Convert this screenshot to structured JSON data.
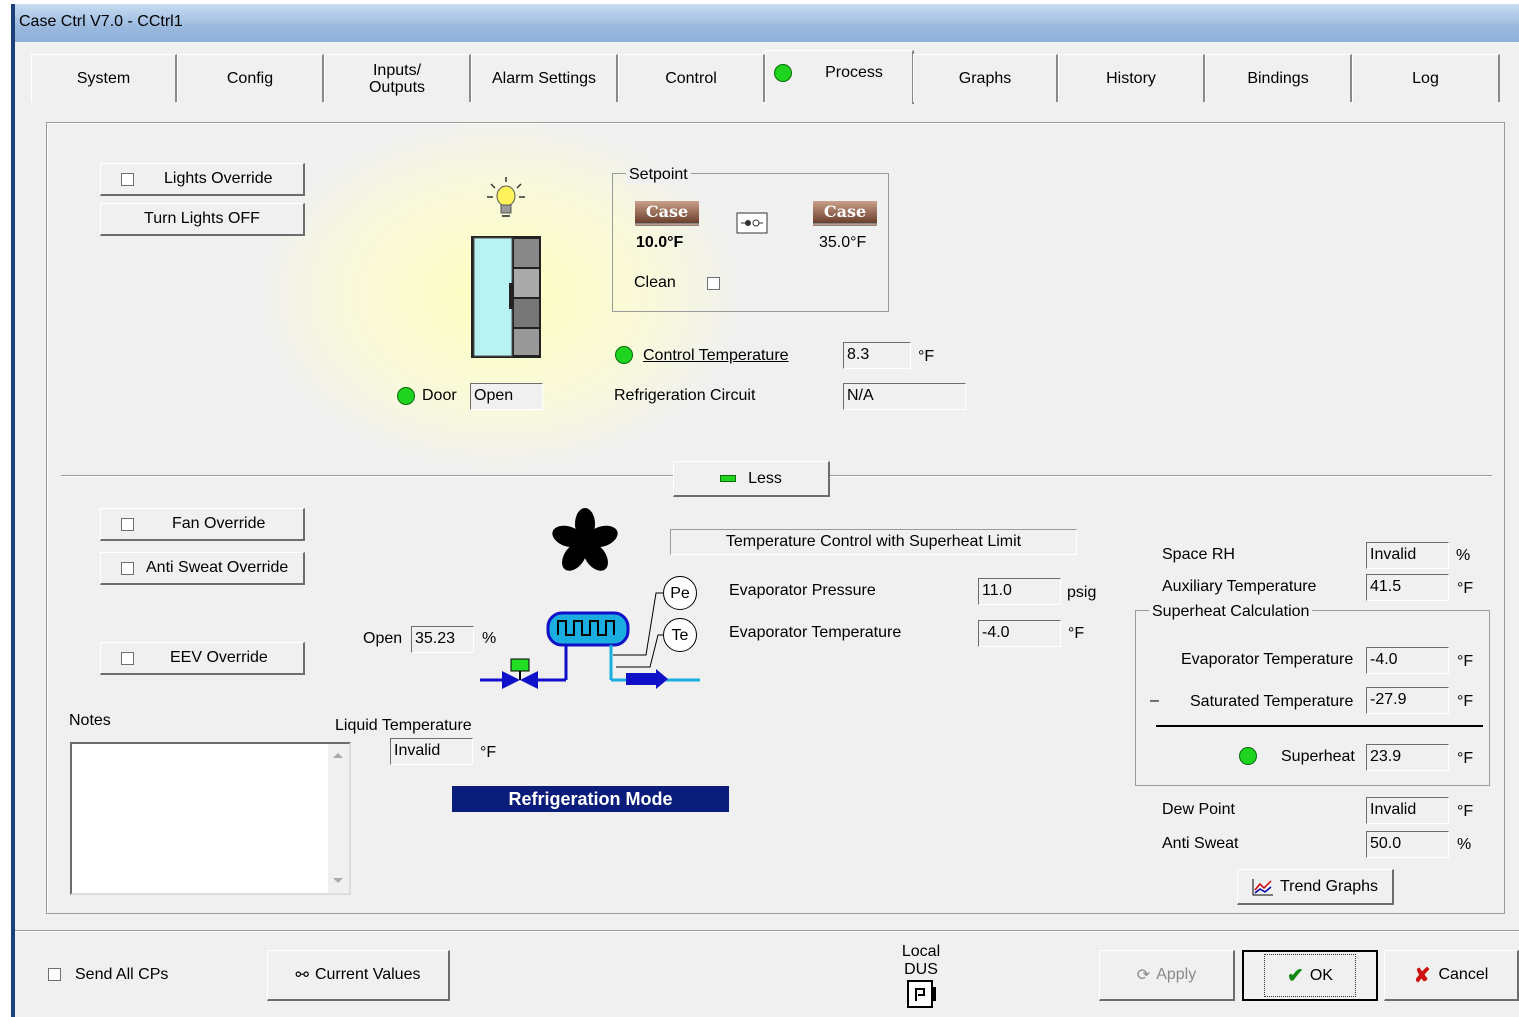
{
  "window": {
    "title": "Case Ctrl V7.0 - CCtrl1"
  },
  "tabs": [
    "System",
    "Config",
    "Inputs/\nOutputs",
    "Alarm Settings",
    "Control",
    "Process",
    "Graphs",
    "History",
    "Bindings",
    "Log"
  ],
  "active_tab": "Process",
  "top": {
    "lights_override": "Lights Override",
    "turn_lights_off": "Turn Lights OFF",
    "door_label": "Door",
    "door_value": "Open",
    "setpoint_legend": "Setpoint",
    "case_badge": "Case",
    "setpoint_left": "10.0°F",
    "setpoint_right": "35.0°F",
    "clean_label": "Clean",
    "control_temp_label": "Control Temperature",
    "control_temp_value": "8.3",
    "control_temp_unit": "°F",
    "refrig_circuit_label": "Refrigeration Circuit",
    "refrig_circuit_value": "N/A",
    "less_button": "Less"
  },
  "bottom": {
    "fan_override": "Fan Override",
    "anti_sweat_override": "Anti Sweat Override",
    "eev_override": "EEV Override",
    "open_label": "Open",
    "open_value": "35.23",
    "open_unit": "%",
    "pe_label": "Pe",
    "te_label": "Te",
    "mode_banner": "Temperature Control with Superheat Limit",
    "evap_pressure_label": "Evaporator Pressure",
    "evap_pressure_value": "11.0",
    "evap_pressure_unit": "psig",
    "evap_temp_label": "Evaporator Temperature",
    "evap_temp_value": "-4.0",
    "evap_temp_unit": "°F",
    "notes_label": "Notes",
    "notes_value": "",
    "liquid_temp_label": "Liquid Temperature",
    "liquid_temp_value": "Invalid",
    "liquid_temp_unit": "°F",
    "refrigeration_mode": "Refrigeration Mode"
  },
  "right": {
    "space_rh_label": "Space RH",
    "space_rh_value": "Invalid",
    "space_rh_unit": "%",
    "aux_temp_label": "Auxiliary Temperature",
    "aux_temp_value": "41.5",
    "aux_temp_unit": "°F",
    "superheat_legend": "Superheat Calculation",
    "sh_evap_temp_label": "Evaporator Temperature",
    "sh_evap_temp_value": "-4.0",
    "sh_evap_temp_unit": "°F",
    "sh_minus": "–",
    "sh_sat_temp_label": "Saturated Temperature",
    "sh_sat_temp_value": "-27.9",
    "sh_sat_temp_unit": "°F",
    "superheat_label": "Superheat",
    "superheat_value": "23.9",
    "superheat_unit": "°F",
    "dew_point_label": "Dew Point",
    "dew_point_value": "Invalid",
    "dew_point_unit": "°F",
    "anti_sweat_label": "Anti Sweat",
    "anti_sweat_value": "50.0",
    "anti_sweat_unit": "%",
    "trend_graphs": "Trend Graphs"
  },
  "footer": {
    "send_all_cps": "Send All CPs",
    "current_values": "Current Values",
    "local_line1": "Local",
    "local_line2": "DUS",
    "apply": "Apply",
    "ok": "OK",
    "cancel": "Cancel"
  },
  "colors": {
    "led_green": "#1ed41e",
    "mode_banner_bg": "#0b1d7a",
    "title_gradient": "#9ab9de"
  }
}
